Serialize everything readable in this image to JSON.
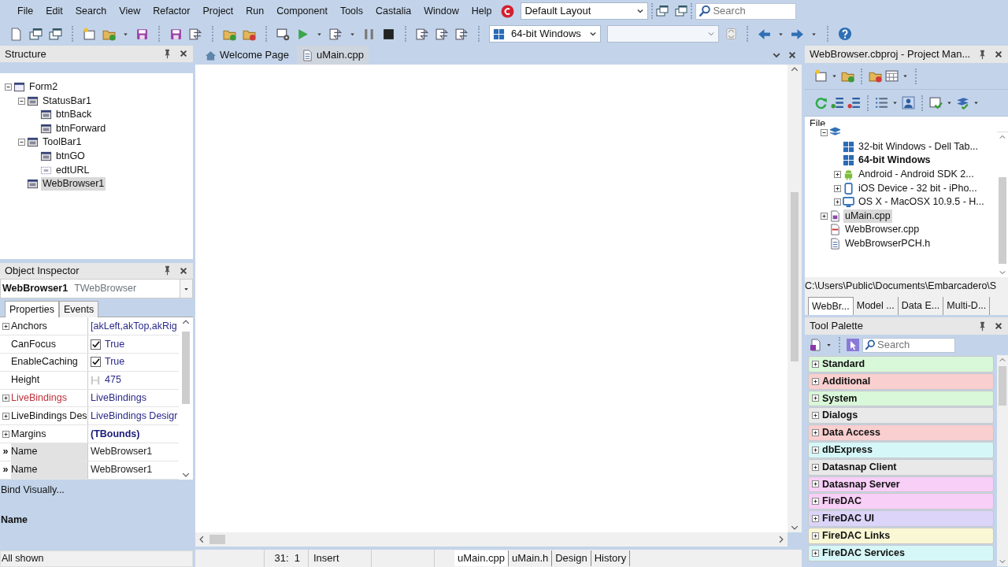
{
  "menu": [
    "File",
    "Edit",
    "Search",
    "View",
    "Refactor",
    "Project",
    "Run",
    "Component",
    "Tools",
    "Castalia",
    "Window",
    "Help"
  ],
  "toolbar": {
    "layout": "Default Layout",
    "search_placeholder": "Search",
    "platform": "64-bit Windows"
  },
  "structure": {
    "title": "Structure",
    "tree": [
      {
        "label": "Form2",
        "kind": "form",
        "selected": false,
        "expanded": true,
        "children": [
          {
            "label": "StatusBar1",
            "kind": "panel",
            "selected": false,
            "expanded": true,
            "children": [
              {
                "label": "btnBack",
                "kind": "button",
                "selected": false
              },
              {
                "label": "btnForward",
                "kind": "button",
                "selected": false
              }
            ]
          },
          {
            "label": "ToolBar1",
            "kind": "panel",
            "selected": false,
            "expanded": true,
            "children": [
              {
                "label": "btnGO",
                "kind": "button",
                "selected": false
              },
              {
                "label": "edtURL",
                "kind": "edit",
                "selected": false
              }
            ]
          },
          {
            "label": "WebBrowser1",
            "kind": "panel",
            "selected": true
          }
        ]
      }
    ]
  },
  "object_inspector": {
    "title": "Object Inspector",
    "object": "WebBrowser1",
    "object_type": "TWebBrowser",
    "tabs": [
      {
        "label": "Properties",
        "selected": true
      },
      {
        "label": "Events",
        "selected": false
      }
    ],
    "properties": [
      {
        "name": "Anchors",
        "value": "[akLeft,akTop,akRig",
        "kind": "set",
        "expandable": true
      },
      {
        "name": "CanFocus",
        "value": "True",
        "kind": "check",
        "expandable": false,
        "checked": true
      },
      {
        "name": "EnableCaching",
        "value": "True",
        "kind": "check",
        "expandable": false,
        "checked": true
      },
      {
        "name": "Height",
        "value": "475",
        "kind": "size",
        "expandable": false
      },
      {
        "name": "LiveBindings",
        "value": "LiveBindings",
        "kind": "binding",
        "expandable": true
      },
      {
        "name": "LiveBindings Des",
        "value": "LiveBindings Desigr",
        "kind": "set",
        "expandable": true
      },
      {
        "name": "Margins",
        "value": "(TBounds)",
        "kind": "object",
        "expandable": true
      },
      {
        "name": "Name",
        "value": "WebBrowser1",
        "kind": "pinned",
        "marker": "»"
      },
      {
        "name": "Name",
        "value": "WebBrowser1",
        "kind": "pinned",
        "marker": "»"
      }
    ],
    "bind_link": "Bind Visually...",
    "description_title": "Name",
    "filter_status": "All shown"
  },
  "editor": {
    "tabs": [
      {
        "label": "Welcome Page",
        "kind": "welcome",
        "selected": false
      },
      {
        "label": "uMain.cpp",
        "kind": "file",
        "selected": true
      }
    ],
    "cursor": "31:  1",
    "mode": "Insert",
    "view_tabs": [
      {
        "label": "uMain.cpp",
        "selected": true
      },
      {
        "label": "uMain.h",
        "selected": false
      },
      {
        "label": "Design",
        "selected": false
      },
      {
        "label": "History",
        "selected": false
      }
    ]
  },
  "project_manager": {
    "title": "WebBrowser.cbproj - Project Man...",
    "column": "File",
    "tree": [
      {
        "kind": "platforms",
        "expanded": true,
        "children": [
          {
            "label": "32-bit Windows - Dell Tab...",
            "kind": "windows",
            "active": false,
            "selected": false
          },
          {
            "label": "64-bit Windows",
            "kind": "windows",
            "active": true,
            "selected": false
          },
          {
            "label": "Android - Android SDK 2...",
            "kind": "android",
            "active": false,
            "selected": false,
            "expanded": false
          },
          {
            "label": "iOS Device - 32 bit - iPho...",
            "kind": "phone",
            "active": false,
            "selected": false,
            "expanded": false
          },
          {
            "label": "OS X - MacOSX 10.9.5 - H...",
            "kind": "monitor",
            "active": false,
            "selected": false,
            "expanded": false
          }
        ]
      },
      {
        "label": "uMain.cpp",
        "kind": "source",
        "active": false,
        "selected": true,
        "expanded": false
      },
      {
        "label": "WebBrowser.cpp",
        "kind": "cpp",
        "active": false,
        "selected": false
      },
      {
        "label": "WebBrowserPCH.h",
        "kind": "header",
        "active": false,
        "selected": false
      }
    ],
    "path": "C:\\Users\\Public\\Documents\\Embarcadero\\S",
    "tabs": [
      {
        "label": "WebBr...",
        "selected": true
      },
      {
        "label": "Model ...",
        "selected": false
      },
      {
        "label": "Data E...",
        "selected": false
      },
      {
        "label": "Multi-D...",
        "selected": false
      }
    ]
  },
  "tool_palette": {
    "title": "Tool Palette",
    "search_placeholder": "Search",
    "categories": [
      {
        "label": "Standard",
        "color": "#d9f7d9"
      },
      {
        "label": "Additional",
        "color": "#f9cfcf"
      },
      {
        "label": "System",
        "color": "#d9f7d9"
      },
      {
        "label": "Dialogs",
        "color": "#e9e9e9"
      },
      {
        "label": "Data Access",
        "color": "#f9cfcf"
      },
      {
        "label": "dbExpress",
        "color": "#d6f7f7"
      },
      {
        "label": "Datasnap Client",
        "color": "#e9e9e9"
      },
      {
        "label": "Datasnap Server",
        "color": "#f7cff7"
      },
      {
        "label": "FireDAC",
        "color": "#f7cff7"
      },
      {
        "label": "FireDAC UI",
        "color": "#dcd4f9"
      },
      {
        "label": "FireDAC Links",
        "color": "#f9f7d4"
      },
      {
        "label": "FireDAC Services",
        "color": "#d6f7f7"
      }
    ]
  }
}
